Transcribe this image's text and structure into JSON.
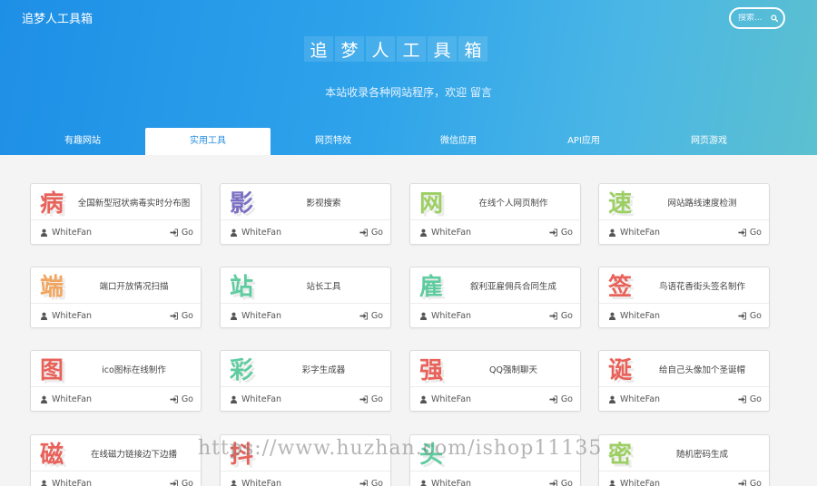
{
  "header": {
    "brand": "追梦人工具箱",
    "search_placeholder": "搜索...",
    "title_chars": [
      "追",
      "梦",
      "人",
      "工",
      "具",
      "箱"
    ],
    "subtitle": "本站收录各种网站程序，欢迎 留言"
  },
  "tabs": [
    {
      "label": "有趣网站",
      "active": false
    },
    {
      "label": "实用工具",
      "active": true
    },
    {
      "label": "网页特效",
      "active": false
    },
    {
      "label": "微信应用",
      "active": false
    },
    {
      "label": "API应用",
      "active": false
    },
    {
      "label": "网页游戏",
      "active": false
    }
  ],
  "cards": [
    {
      "glyph": "病",
      "color": "#e8625a",
      "name": "全国新型冠状病毒实时分布图",
      "author": "WhiteFan",
      "go": "Go"
    },
    {
      "glyph": "影",
      "color": "#7b6fc4",
      "name": "影视搜索",
      "author": "WhiteFan",
      "go": "Go"
    },
    {
      "glyph": "网",
      "color": "#9ccf63",
      "name": "在线个人网页制作",
      "author": "WhiteFan",
      "go": "Go"
    },
    {
      "glyph": "速",
      "color": "#9ccf63",
      "name": "网站路线速度检测",
      "author": "WhiteFan",
      "go": "Go"
    },
    {
      "glyph": "端",
      "color": "#f2a55e",
      "name": "端口开放情况扫描",
      "author": "WhiteFan",
      "go": "Go"
    },
    {
      "glyph": "站",
      "color": "#5fcca0",
      "name": "站长工具",
      "author": "WhiteFan",
      "go": "Go"
    },
    {
      "glyph": "雇",
      "color": "#5fcca0",
      "name": "叙利亚雇佣兵合同生成",
      "author": "WhiteFan",
      "go": "Go"
    },
    {
      "glyph": "签",
      "color": "#e8625a",
      "name": "鸟语花香街头签名制作",
      "author": "WhiteFan",
      "go": "Go"
    },
    {
      "glyph": "图",
      "color": "#e8625a",
      "name": "ico图标在线制作",
      "author": "WhiteFan",
      "go": "Go"
    },
    {
      "glyph": "彩",
      "color": "#5fcca0",
      "name": "彩字生成器",
      "author": "WhiteFan",
      "go": "Go"
    },
    {
      "glyph": "强",
      "color": "#e8625a",
      "name": "QQ强制聊天",
      "author": "WhiteFan",
      "go": "Go"
    },
    {
      "glyph": "诞",
      "color": "#e8625a",
      "name": "给自己头像加个圣诞帽",
      "author": "WhiteFan",
      "go": "Go"
    },
    {
      "glyph": "磁",
      "color": "#e8625a",
      "name": "在线磁力链接边下边播",
      "author": "WhiteFan",
      "go": "Go"
    },
    {
      "glyph": "抖",
      "color": "#e8625a",
      "name": "",
      "author": "WhiteFan",
      "go": "Go"
    },
    {
      "glyph": "头",
      "color": "#5fcca0",
      "name": "",
      "author": "WhiteFan",
      "go": "Go"
    },
    {
      "glyph": "密",
      "color": "#9ccf63",
      "name": "随机密码生成",
      "author": "WhiteFan",
      "go": "Go"
    }
  ],
  "watermark": "https://www.huzhan.com/ishop11135"
}
